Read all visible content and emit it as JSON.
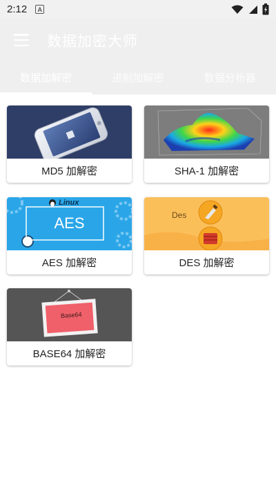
{
  "status": {
    "time": "2:12",
    "notif_letter": "A"
  },
  "appbar": {
    "title": "数据加密大师",
    "tabs": [
      {
        "label": "数据加解密"
      },
      {
        "label": "进制加解密"
      },
      {
        "label": "数据分析器"
      }
    ]
  },
  "cards": [
    {
      "label": "MD5 加解密",
      "image": "phone-mockup"
    },
    {
      "label": "SHA-1 加解密",
      "image": "3d-surface-plot"
    },
    {
      "label": "AES 加解密",
      "image": "linux-aes-banner",
      "badge": "Linux",
      "word": "AES"
    },
    {
      "label": "DES 加解密",
      "image": "des-tools",
      "word": "Des"
    },
    {
      "label": "BASE64 加解密",
      "image": "base64-frame",
      "word": "Base64"
    }
  ]
}
